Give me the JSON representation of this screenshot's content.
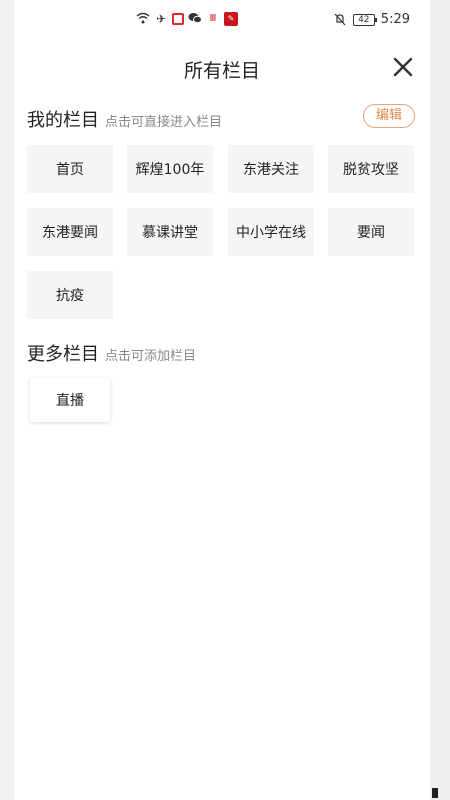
{
  "status_bar": {
    "time": "5:29",
    "battery": "42"
  },
  "header": {
    "title": "所有栏目"
  },
  "my_channels": {
    "title": "我的栏目",
    "hint": "点击可直接进入栏目",
    "edit_label": "编辑",
    "items": [
      {
        "label": "首页"
      },
      {
        "label": "辉煌100年"
      },
      {
        "label": "东港关注"
      },
      {
        "label": "脱贫攻坚"
      },
      {
        "label": "东港要闻"
      },
      {
        "label": "慕课讲堂"
      },
      {
        "label": "中小学在线"
      },
      {
        "label": "要闻"
      },
      {
        "label": "抗疫"
      }
    ]
  },
  "more_channels": {
    "title": "更多栏目",
    "hint": "点击可添加栏目",
    "items": [
      {
        "label": "直播"
      }
    ]
  },
  "colors": {
    "accent": "#e08a4f"
  }
}
